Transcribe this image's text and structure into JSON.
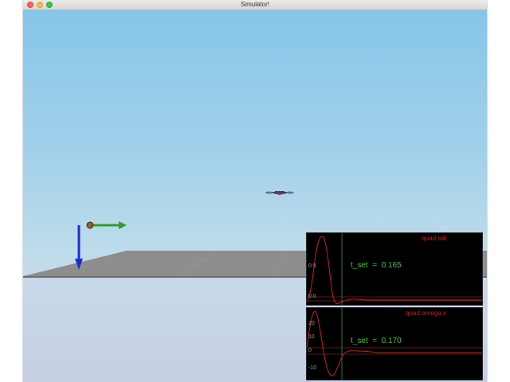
{
  "window": {
    "title": "Simulator!"
  },
  "colors": {
    "accent_green": "#3fc43f",
    "plot_red": "#c82020",
    "axis_x": "#2aa02a",
    "axis_z": "#1a2fd0"
  },
  "plots": [
    {
      "title": "quad.roll",
      "tset_label": "t_set",
      "tset_eq": "=",
      "tset_value": "0.165",
      "ticks": [
        "0.5",
        "0.0"
      ]
    },
    {
      "title": "quad.omega.x",
      "tset_label": "t_set",
      "tset_eq": "=",
      "tset_value": "0.170",
      "ticks": [
        "20",
        "10",
        "0",
        "-10"
      ]
    }
  ]
}
